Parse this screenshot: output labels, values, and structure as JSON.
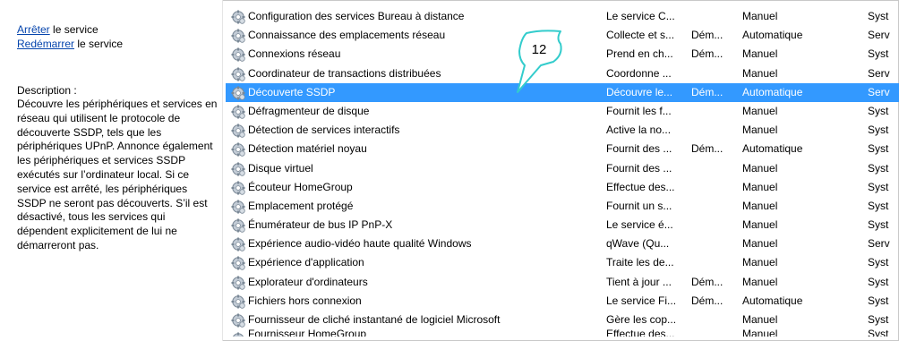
{
  "actions": {
    "stop_link": "Arrêter",
    "stop_suffix": " le service",
    "restart_link": "Redémarrer",
    "restart_suffix": " le service"
  },
  "description": {
    "title": "Description :",
    "text": "Découvre les périphériques et services en réseau qui utilisent le protocole de découverte SSDP, tels que les périphériques UPnP. Annonce également les périphériques et services SSDP exécutés sur l’ordinateur local. Si ce service est arrêté, les périphériques SSDP ne seront pas découverts. S’il est désactivé, tous les services qui dépendent explicitement de lui ne démarreront pas."
  },
  "callout": {
    "label": "12",
    "color": "#33cccc"
  },
  "colors": {
    "selection": "#3399ff",
    "link": "#0645ad"
  },
  "services": [
    {
      "name": "Configuration des services Bureau à distance",
      "desc": "Le service C...",
      "state": "",
      "startup": "Manuel",
      "logon": "Syst"
    },
    {
      "name": "Connaissance des emplacements réseau",
      "desc": "Collecte et s...",
      "state": "Dém...",
      "startup": "Automatique",
      "logon": "Serv"
    },
    {
      "name": "Connexions réseau",
      "desc": "Prend en ch...",
      "state": "Dém...",
      "startup": "Manuel",
      "logon": "Syst"
    },
    {
      "name": "Coordinateur de transactions distribuées",
      "desc": "Coordonne ...",
      "state": "",
      "startup": "Manuel",
      "logon": "Serv"
    },
    {
      "name": "Découverte SSDP",
      "desc": "Découvre le...",
      "state": "Dém...",
      "startup": "Automatique",
      "logon": "Serv"
    },
    {
      "name": "Défragmenteur de disque",
      "desc": "Fournit les f...",
      "state": "",
      "startup": "Manuel",
      "logon": "Syst"
    },
    {
      "name": "Détection de services interactifs",
      "desc": "Active la no...",
      "state": "",
      "startup": "Manuel",
      "logon": "Syst"
    },
    {
      "name": "Détection matériel noyau",
      "desc": "Fournit des ...",
      "state": "Dém...",
      "startup": "Automatique",
      "logon": "Syst"
    },
    {
      "name": "Disque virtuel",
      "desc": "Fournit des ...",
      "state": "",
      "startup": "Manuel",
      "logon": "Syst"
    },
    {
      "name": "Écouteur HomeGroup",
      "desc": "Effectue des...",
      "state": "",
      "startup": "Manuel",
      "logon": "Syst"
    },
    {
      "name": "Emplacement protégé",
      "desc": "Fournit un s...",
      "state": "",
      "startup": "Manuel",
      "logon": "Syst"
    },
    {
      "name": "Énumérateur de bus IP PnP-X",
      "desc": "Le service é...",
      "state": "",
      "startup": "Manuel",
      "logon": "Syst"
    },
    {
      "name": "Expérience audio-vidéo haute qualité Windows",
      "desc": "qWave (Qu...",
      "state": "",
      "startup": "Manuel",
      "logon": "Serv"
    },
    {
      "name": "Expérience d'application",
      "desc": "Traite les de...",
      "state": "",
      "startup": "Manuel",
      "logon": "Syst"
    },
    {
      "name": "Explorateur d'ordinateurs",
      "desc": "Tient à jour ...",
      "state": "Dém...",
      "startup": "Manuel",
      "logon": "Syst"
    },
    {
      "name": "Fichiers hors connexion",
      "desc": "Le service Fi...",
      "state": "Dém...",
      "startup": "Automatique",
      "logon": "Syst"
    },
    {
      "name": "Fournisseur de cliché instantané de logiciel Microsoft",
      "desc": "Gère les cop...",
      "state": "",
      "startup": "Manuel",
      "logon": "Syst"
    },
    {
      "name": "Fournisseur HomeGroup",
      "desc": "Effectue des...",
      "state": "",
      "startup": "Manuel",
      "logon": "Syst"
    }
  ]
}
